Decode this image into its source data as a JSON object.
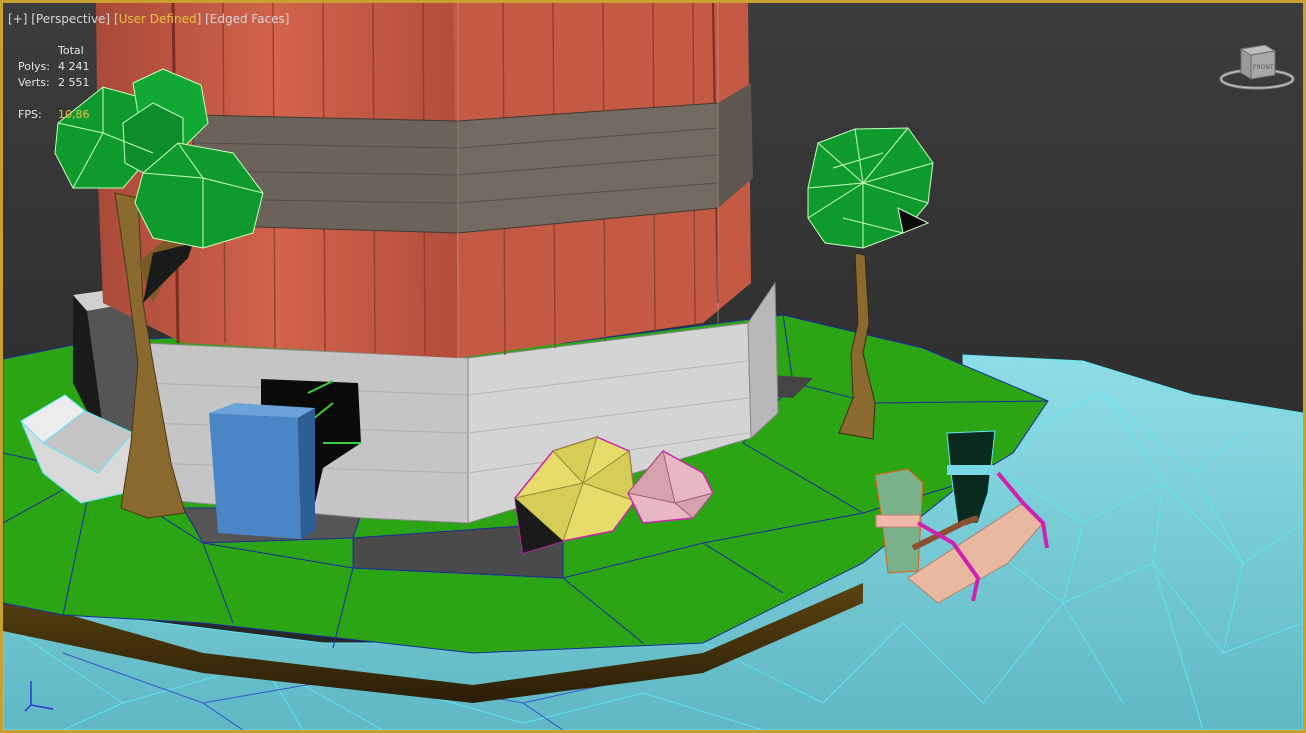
{
  "viewport": {
    "labels": {
      "plus": "[+]",
      "perspective": "[Perspective]",
      "bracket_open": "[",
      "shading": "User Defined",
      "bracket_close": "]",
      "edged_faces": "[Edged Faces]"
    },
    "stats": {
      "header": "Total",
      "polys_label": "Polys:",
      "polys_value": "4 241",
      "verts_label": "Verts:",
      "verts_value": "2 551",
      "fps_label": "FPS:",
      "fps_value": "10,86"
    },
    "viewcube_face": "FRONT",
    "colors": {
      "active_border": "#c8a030",
      "active_label": "#e8c040",
      "grass": "#2ca514",
      "water": "#7fd6e0",
      "brick": "#c65a44",
      "stone_band": "#6b625a",
      "base": "#c9c9c9",
      "door": "#4a86c6",
      "trunk": "#8a6a2e",
      "foliage": "#0f9a2e",
      "rock_yellow": "#e6dc6a",
      "rock_pink": "#e8b8c2",
      "selection_magenta": "#d020b0"
    }
  }
}
